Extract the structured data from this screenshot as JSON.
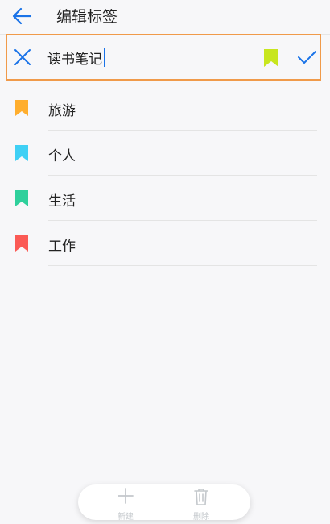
{
  "header": {
    "title": "编辑标签",
    "back_icon": "arrow-left-icon"
  },
  "editor": {
    "value": "读书笔记",
    "cancel_icon": "close-icon",
    "color_icon": "bookmark-icon",
    "color": "#c8e61e",
    "confirm_icon": "check-icon",
    "accent": "#1a73e8",
    "border_color": "#f09a4a"
  },
  "tags": [
    {
      "label": "旅游",
      "color": "#ffae2e",
      "icon": "bookmark-icon"
    },
    {
      "label": "个人",
      "color": "#3fd0f5",
      "icon": "bookmark-icon"
    },
    {
      "label": "生活",
      "color": "#2fd09c",
      "icon": "bookmark-icon"
    },
    {
      "label": "工作",
      "color": "#fb5a55",
      "icon": "bookmark-icon"
    }
  ],
  "bottom_bar": {
    "new_label": "新建",
    "new_icon": "plus-icon",
    "delete_label": "删除",
    "delete_icon": "trash-icon",
    "disabled_color": "#c4c8cc"
  }
}
